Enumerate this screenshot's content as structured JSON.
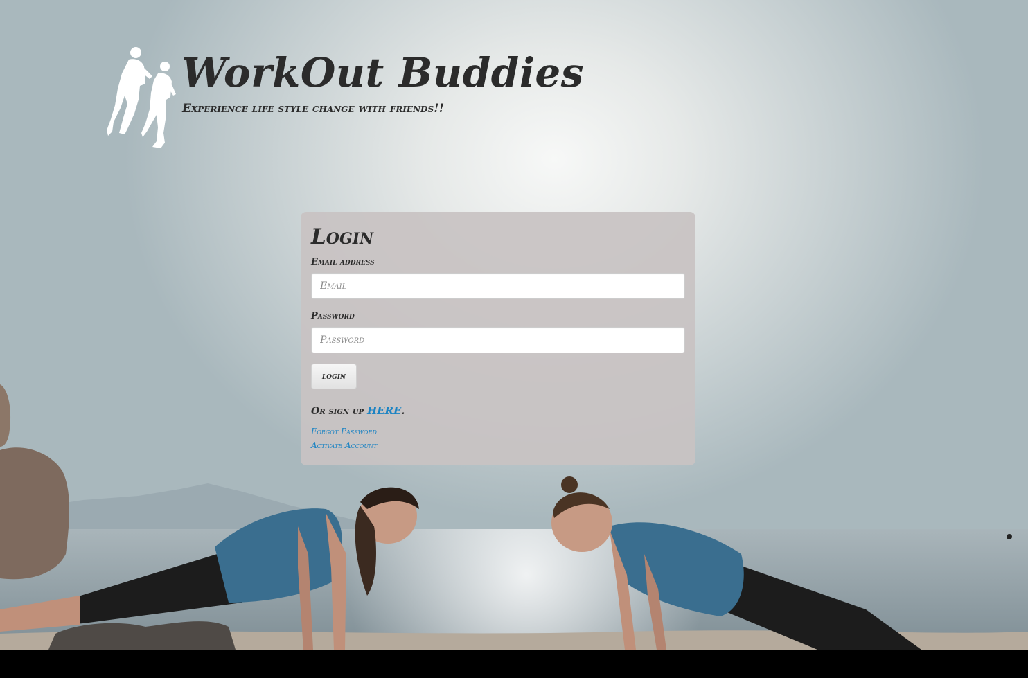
{
  "brand": {
    "title": "WorkOut Buddies",
    "tagline": "Experience life style change with friends!!",
    "logo_icon": "runners-silhouette-icon"
  },
  "login": {
    "heading": "Login",
    "email_label": "Email address",
    "email_placeholder": "Email",
    "email_value": "",
    "password_label": "Password",
    "password_placeholder": "Password",
    "password_value": "",
    "button_label": "login",
    "signup_prefix": "Or sign up ",
    "signup_link": "HERE",
    "signup_suffix": ".",
    "forgot_password": "Forgot Password",
    "activate_account": "Activate Account"
  },
  "colors": {
    "text": "#2b2b2b",
    "link": "#1b83c3",
    "card": "#cac5c5",
    "bottom_bar": "#000000"
  },
  "background": {
    "scene": "two women doing plank exercise on a beach facing each other, sea and rocks behind"
  }
}
